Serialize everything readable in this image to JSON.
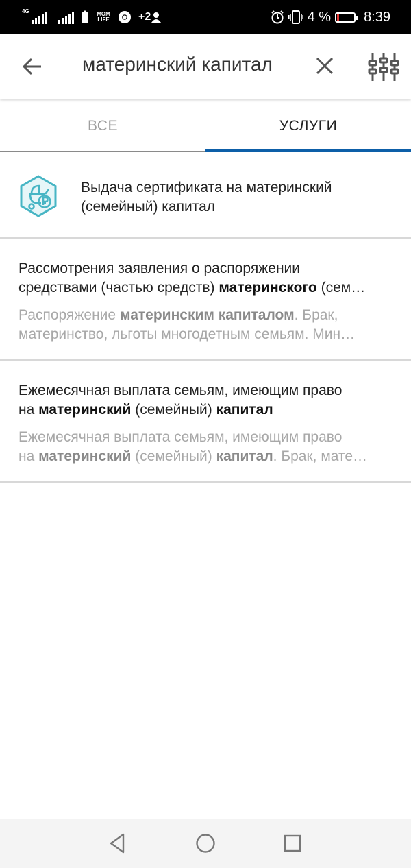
{
  "status_bar": {
    "network": "4G",
    "app_badge": "MOM LIFE",
    "add_contact": "+2",
    "battery_percent": "4 %",
    "time": "8:39",
    "icons": [
      "signal-icon",
      "battery-saver-icon",
      "chrome-icon",
      "alarm-icon",
      "vibrate-icon",
      "battery-icon"
    ]
  },
  "search": {
    "query": "материнский капитал",
    "back_icon": "arrow-left-icon",
    "clear_icon": "close-icon",
    "filter_icon": "filter-sliders-icon"
  },
  "tabs": [
    {
      "label": "ВСЕ",
      "selected": false
    },
    {
      "label": "УСЛУГИ",
      "selected": true
    }
  ],
  "accent_color": "#0d5fa8",
  "results": [
    {
      "icon": "baby-stroller-ruble-icon",
      "title": "Выдача сертификата на материнский (семейный) капитал"
    },
    {
      "title_parts": [
        "Рассмотрения заявления о распоряжении",
        "средствами (частью средств) ",
        "материнского",
        " (сем…"
      ],
      "desc_parts": [
        "Распоряжение ",
        "материнским капиталом",
        ". Брак,",
        "материнство, льготы многодетным семьям. Мин…"
      ]
    },
    {
      "title_parts": [
        "Ежемесячная выплата семьям, имеющим право",
        "на ",
        "материнский",
        " (семейный) ",
        "капитал"
      ],
      "desc_parts": [
        "Ежемесячная выплата семьям, имеющим право",
        "на ",
        "материнский",
        " (семейный) ",
        "капитал",
        ". Брак, мате…"
      ]
    }
  ],
  "nav_bar": {
    "icons": [
      "nav-back-icon",
      "nav-home-icon",
      "nav-recents-icon"
    ]
  }
}
